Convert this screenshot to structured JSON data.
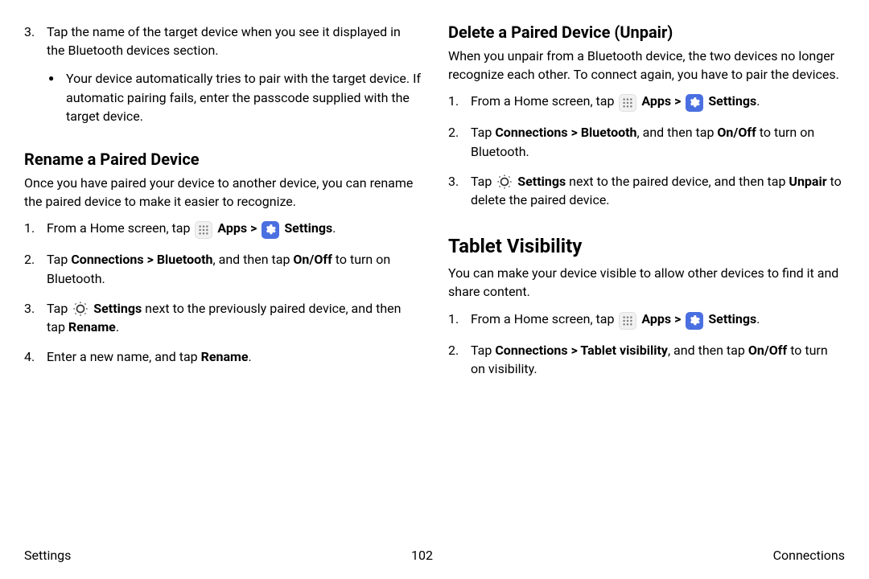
{
  "left": {
    "step3": "Tap the name of the target device when you see it displayed in the Bluetooth devices section.",
    "bullet": "Your device automatically tries to pair with the target device. If automatic pairing fails, enter the passcode supplied with the target device.",
    "rename_h": "Rename a Paired Device",
    "rename_p": "Once you have paired your device to another device, you can rename the paired device to make it easier to recognize.",
    "s1a": "From a Home screen, tap ",
    "apps": "Apps",
    "chev": " > ",
    "settings": "Settings",
    "period": ".",
    "s2a": "Tap ",
    "conn_bt": "Connections > Bluetooth",
    "s2b": ", and then tap ",
    "onoff": "On/Off",
    "s2c": " to turn on Bluetooth.",
    "s3a": "Tap ",
    "s3set": "Settings",
    "s3b": " next to the previously paired device, and then tap ",
    "rename": "Rename",
    "s4a": "Enter a new name, and tap ",
    "s4b": "Rename"
  },
  "right": {
    "del_h": "Delete a Paired Device (Unpair)",
    "del_p": "When you unpair from a Bluetooth device, the two devices no longer recognize each other. To connect again, you have to pair the devices.",
    "s1a": "From a Home screen, tap ",
    "apps": "Apps",
    "chev": " > ",
    "settings": "Settings",
    "period": ".",
    "s2a": "Tap ",
    "conn_bt": "Connections > Bluetooth",
    "s2b": ", and then tap ",
    "onoff": "On/Off",
    "s2c": " to turn on Bluetooth.",
    "s3a": "Tap ",
    "s3set": "Settings",
    "s3b": " next to the paired device, and then tap ",
    "unpair": "Unpair",
    "s3c": " to delete the paired device.",
    "vis_h": "Tablet Visibility",
    "vis_p": "You can make your device visible to allow other devices to find it and share content.",
    "v1a": "From a Home screen, tap ",
    "v2a": "Tap ",
    "conn_vis": "Connections > Tablet visibility",
    "v2b": ", and then tap ",
    "v2c": " to turn on visibility."
  },
  "footer": {
    "left": "Settings",
    "page": "102",
    "right": "Connections"
  }
}
